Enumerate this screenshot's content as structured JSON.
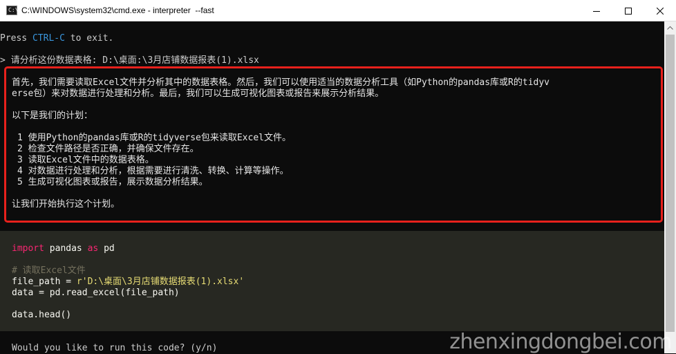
{
  "window": {
    "title": "C:\\WINDOWS\\system32\\cmd.exe - interpreter  --fast",
    "icon": "C:\\",
    "controls": {
      "minimize": "minimize-icon",
      "maximize": "maximize-icon",
      "close": "close-icon"
    }
  },
  "terminal": {
    "intro_prefix": "Press ",
    "intro_key": "CTRL-C",
    "intro_suffix": " to exit.",
    "user_prompt_symbol": ">",
    "user_message": "请分析这份数据表格: D:\\桌面:\\3月店铺数据报表(1).xlsx",
    "response": {
      "para1_line1": "首先，我们需要读取Excel文件并分析其中的数据表格。然后，我们可以使用适当的数据分析工具（如Python的pandas库或R的tidyv",
      "para1_line2": "erse包）来对数据进行处理和分析。最后，我们可以生成可视化图表或报告来展示分析结果。",
      "plan_intro": "以下是我们的计划：",
      "plan": [
        {
          "num": "1",
          "text": "使用Python的pandas库或R的tidyverse包来读取Excel文件。"
        },
        {
          "num": "2",
          "text": "检查文件路径是否正确，并确保文件存在。"
        },
        {
          "num": "3",
          "text": "读取Excel文件中的数据表格。"
        },
        {
          "num": "4",
          "text": "对数据进行处理和分析，根据需要进行清洗、转换、计算等操作。"
        },
        {
          "num": "5",
          "text": "生成可视化图表或报告，展示数据分析结果。"
        }
      ],
      "closing": "让我们开始执行这个计划。"
    },
    "code": {
      "l1_kw1": "import",
      "l1_mod": " pandas ",
      "l1_kw2": "as",
      "l1_alias": " pd",
      "l2_comment": "# 读取Excel文件",
      "l3_var": "file_path = ",
      "l3_str": "r'D:\\桌面\\3月店铺数据报表(1).xlsx'",
      "l4": "data = pd.read_excel(file_path)",
      "l5": "data.head()"
    },
    "run_prompt": "Would you like to run this code? (y/n)"
  },
  "watermark": "zhenxingdongbei.com",
  "colors": {
    "highlight_box": "#e8211c",
    "code_bg": "#272822",
    "keyword": "#f92672",
    "string": "#e6db74",
    "comment": "#75715e",
    "ctrl_c": "#3a96dd"
  }
}
